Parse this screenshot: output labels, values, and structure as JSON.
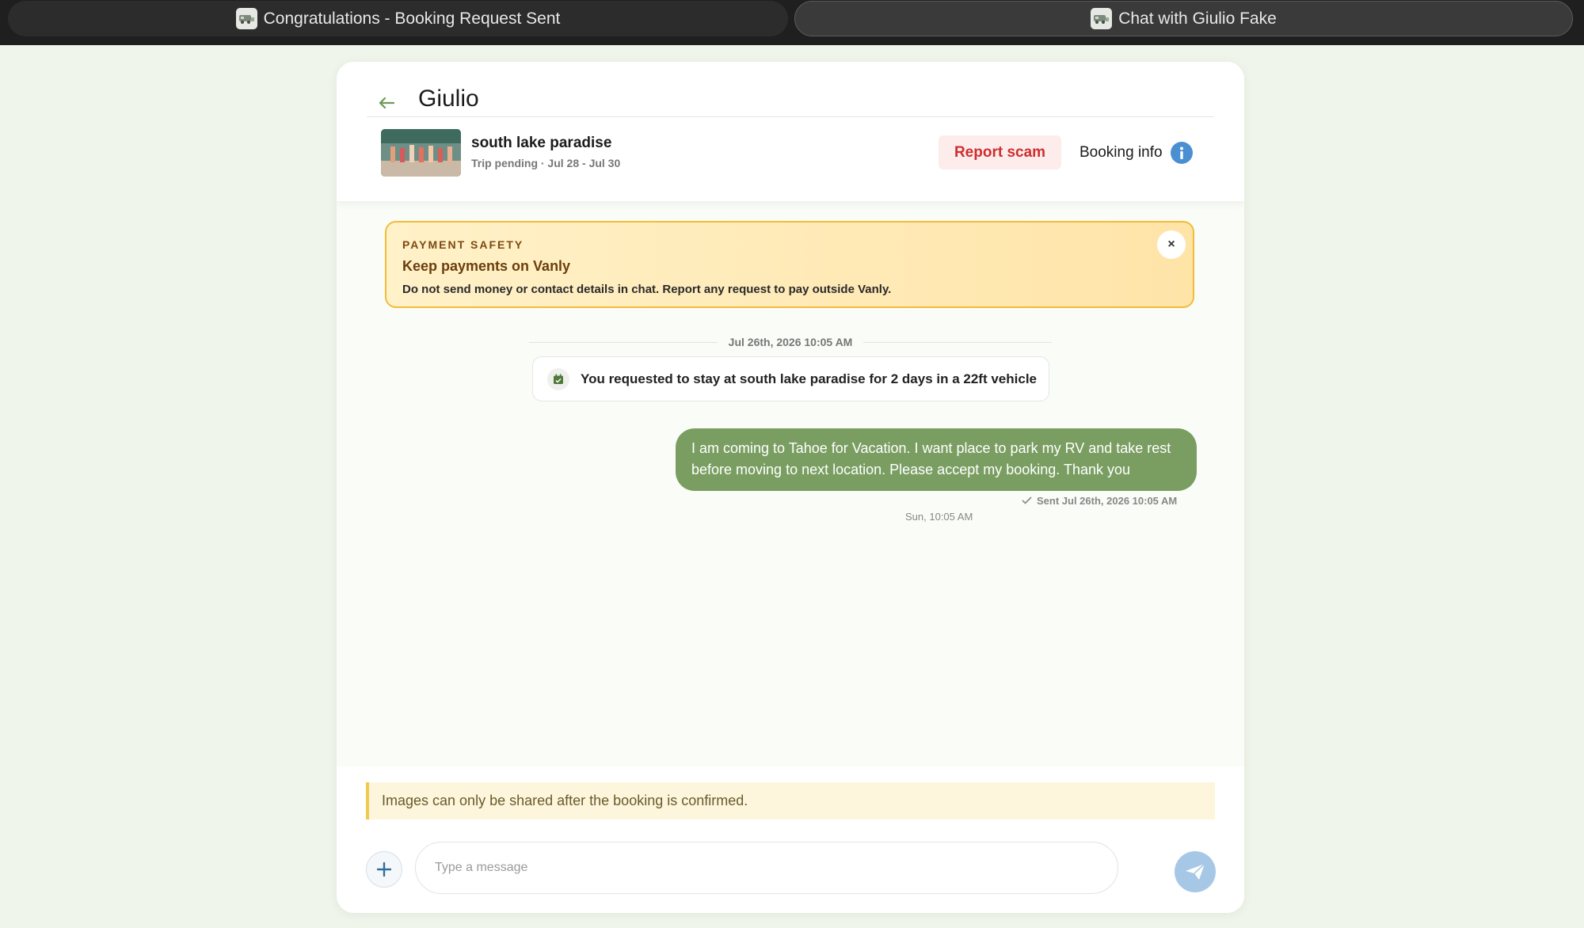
{
  "browser": {
    "tabs": [
      {
        "label": "Congratulations - Booking Request Sent",
        "icon": "site-favicon-icon"
      },
      {
        "label": "Chat with Giulio Fake",
        "icon": "site-favicon-icon"
      }
    ]
  },
  "chat": {
    "title": "Giulio"
  },
  "listing": {
    "name": "south lake paradise",
    "status": "Trip pending · Jul 28 - Jul 30"
  },
  "header_actions": {
    "report_label": "Report scam",
    "booking_info_label": "Booking info"
  },
  "safety_banner": {
    "kicker": "PAYMENT SAFETY",
    "title": "Keep payments on Vanly",
    "body": "Do not send money or contact details in chat. Report any request to pay outside Vanly.",
    "close_glyph": "×"
  },
  "timeline": {
    "date_separator": "Jul 26th, 2026 10:05 AM",
    "system_message": "You requested to stay at south lake paradise for 2 days in a 22ft vehicle",
    "outgoing_message": "I am coming to Tahoe for Vacation. I want place to park my RV and take rest before moving to next location. Please accept my booking. Thank you",
    "sent_status": "Sent Jul 26th, 2026 10:05 AM",
    "day_time": "Sun, 10:05 AM"
  },
  "composer": {
    "notice": "Images can only be shared after the booking is confirmed.",
    "placeholder": "Type a message",
    "value": ""
  },
  "colors": {
    "accent_green": "#7a9e62",
    "report_red": "#cf2e2e",
    "info_blue": "#4a8fd1",
    "banner_border": "#f2bc3a"
  }
}
